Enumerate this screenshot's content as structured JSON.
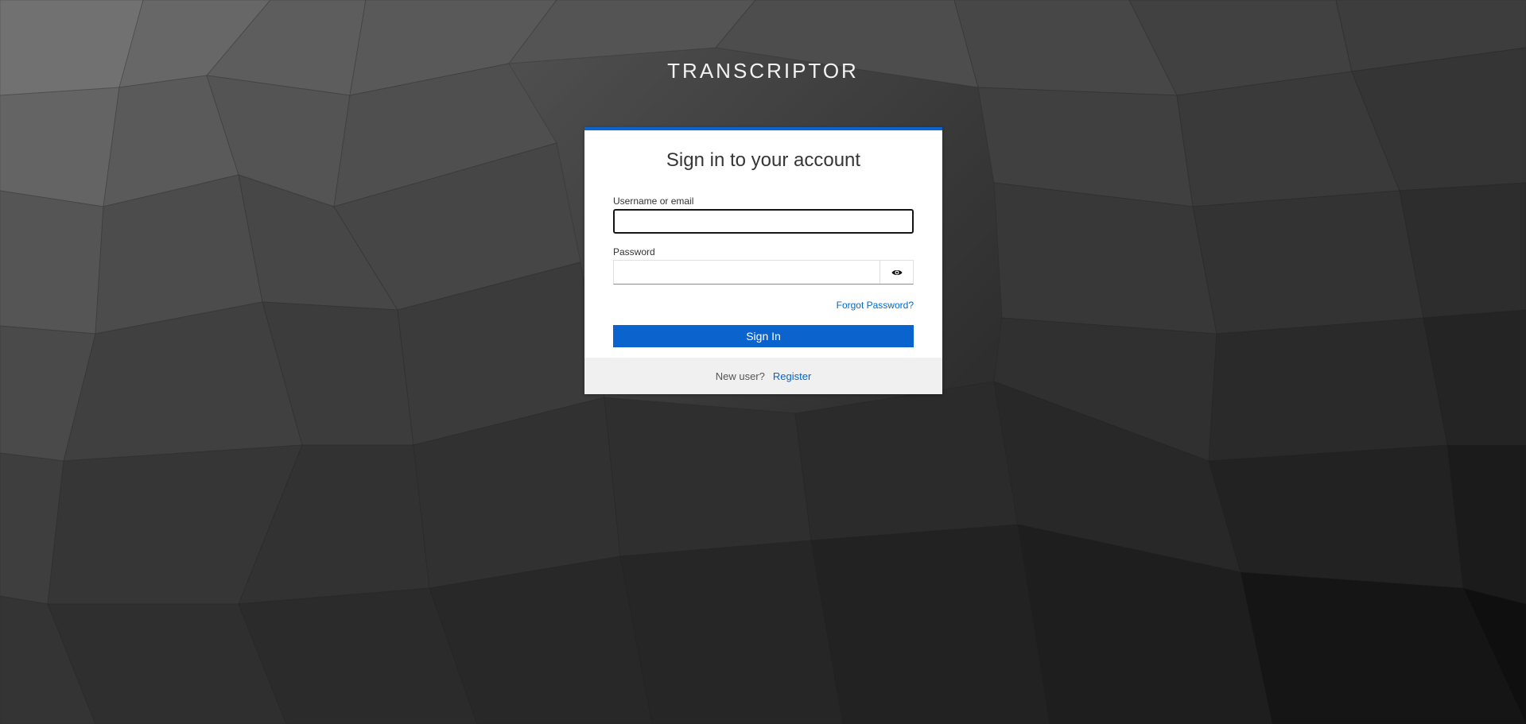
{
  "brand": {
    "title": "TRANSCRIPTOR"
  },
  "login": {
    "heading": "Sign in to your account",
    "username_label": "Username or email",
    "username_value": "",
    "password_label": "Password",
    "password_value": "",
    "show_password_icon": "eye-icon",
    "forgot_password_label": "Forgot Password?",
    "sign_in_label": "Sign In"
  },
  "footer": {
    "new_user_text": "New user?",
    "register_label": "Register"
  },
  "colors": {
    "accent": "#0b63ce",
    "link": "#0066cc",
    "footer_background": "#f0f0f0"
  }
}
